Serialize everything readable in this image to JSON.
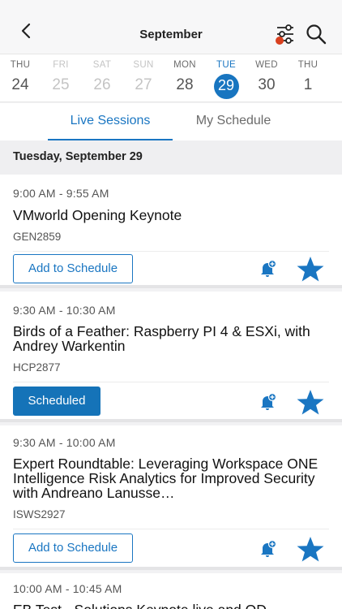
{
  "header": {
    "title": "September"
  },
  "days": [
    {
      "name": "THU",
      "num": "24"
    },
    {
      "name": "FRI",
      "num": "25"
    },
    {
      "name": "SAT",
      "num": "26"
    },
    {
      "name": "SUN",
      "num": "27"
    },
    {
      "name": "MON",
      "num": "28"
    },
    {
      "name": "TUE",
      "num": "29"
    },
    {
      "name": "WED",
      "num": "30"
    },
    {
      "name": "THU",
      "num": "1"
    }
  ],
  "tabs": {
    "live": "Live Sessions",
    "my": "My Schedule"
  },
  "date_header": "Tuesday, September 29",
  "sessions": [
    {
      "time": "9:00 AM - 9:55 AM",
      "title": "VMworld Opening Keynote",
      "code": "GEN2859",
      "button": "Add to Schedule"
    },
    {
      "time": "9:30 AM - 10:30 AM",
      "title": "Birds of a Feather: Raspberry PI 4 & ESXi, with Andrey Warkentin",
      "code": "HCP2877",
      "button": "Scheduled"
    },
    {
      "time": "9:30 AM - 10:00 AM",
      "title": "Expert Roundtable: Leveraging Workspace ONE Intelligence Risk Analytics for Improved Security with Andreano Lanusse…",
      "code": "ISWS2927",
      "button": "Add to Schedule"
    },
    {
      "time": "10:00 AM - 10:45 AM",
      "title": "EB Test - Solutions Keynote live and OD"
    }
  ],
  "icons": {
    "back": "chevron-left-icon",
    "filter": "filter-sliders-icon",
    "search": "search-icon",
    "bell": "bell-plus-icon",
    "star": "star-icon"
  },
  "colors": {
    "accent": "#1a76c2",
    "filter_dot": "#d9401f",
    "muted_day": "#c4c4c4"
  }
}
